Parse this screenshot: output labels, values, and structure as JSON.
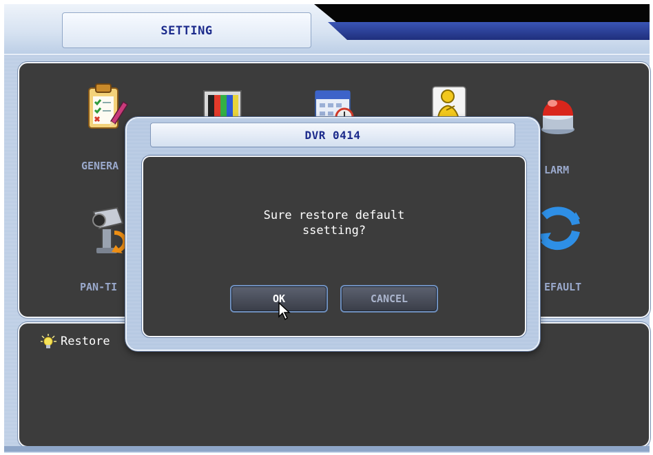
{
  "header": {
    "title": "SETTING"
  },
  "menu": {
    "items": [
      {
        "label": "GENERA",
        "icon": "general-settings-icon"
      },
      {
        "label": "",
        "icon": "display-color-bars-icon"
      },
      {
        "label": "",
        "icon": "schedule-calendar-icon"
      },
      {
        "label": "",
        "icon": "user-icon"
      },
      {
        "label": "LARM",
        "icon": "alarm-siren-icon"
      },
      {
        "label": "PAN-TI",
        "icon": "pan-tilt-camera-icon"
      },
      {
        "label": "EFAULT",
        "icon": "default-restore-icon"
      }
    ]
  },
  "status": {
    "icon": "lightbulb-icon",
    "text": "Restore"
  },
  "dialog": {
    "title": "DVR 0414",
    "message_line1": "Sure restore default",
    "message_line2": "ssetting?",
    "ok_label": "OK",
    "cancel_label": "CANCEL"
  },
  "colors": {
    "title_text": "#1c2b8c",
    "panel_bg": "#3c3c3c",
    "frame_blue": "#b2c5df",
    "menu_label": "#9aa9cc",
    "button_border": "#6f8fbd"
  }
}
